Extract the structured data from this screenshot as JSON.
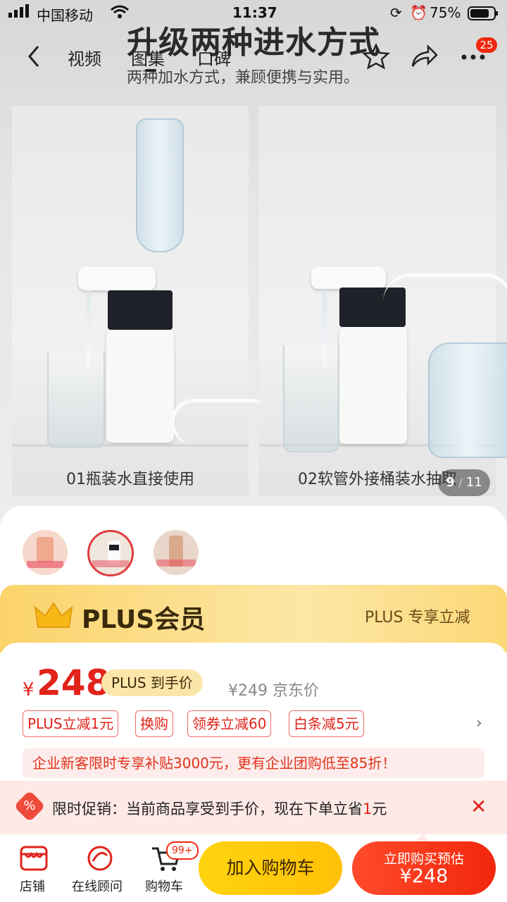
{
  "status_bar": {
    "carrier": "中国移动",
    "time": "11:37",
    "battery": "75%"
  },
  "nav": {
    "tabs": [
      "视频",
      "图集",
      "口碑"
    ],
    "active_tab": "图集",
    "cart_badge": "25",
    "icons": [
      "back-icon",
      "star-icon",
      "share-icon",
      "more-icon"
    ]
  },
  "hero": {
    "title": "升级两种进水方式",
    "subtitle": "两种加水方式，兼顾便携与实用。",
    "left_caption": "01瓶装水直接使用",
    "right_caption": "02软管外接桶装水抽取",
    "counter_current": "9",
    "counter_total": "11"
  },
  "plus": {
    "title": "PLUS会员",
    "right_text": "PLUS 专享立减"
  },
  "price": {
    "symbol": "¥",
    "value": "248",
    "plus_tag": "PLUS 到手价",
    "jd_price": "¥249 京东价"
  },
  "coupons": [
    "PLUS立减1元",
    "换购",
    "领券立减60",
    "白条减5元"
  ],
  "coupon_more": "›",
  "promo_banner": "企业新客限时专享补贴3000元，更有企业团购低至85折！",
  "flash_sale": {
    "icon": "%",
    "text_prefix": "限时促销：当前商品享受到手价，现在下单立省",
    "amount": "1",
    "text_suffix": "元",
    "close": "✕"
  },
  "bottom_bar": {
    "store_label": "店铺",
    "service_label": "在线顾问",
    "cart_label": "购物车",
    "cart_count": "99+",
    "add_to_cart": "加入购物车",
    "buy_line1": "立即购买预估",
    "buy_line2": "¥248"
  },
  "colors": {
    "accent": "#f2270c",
    "plus_gold": "#fbd36a",
    "cart_yellow": "#ffd30f"
  }
}
